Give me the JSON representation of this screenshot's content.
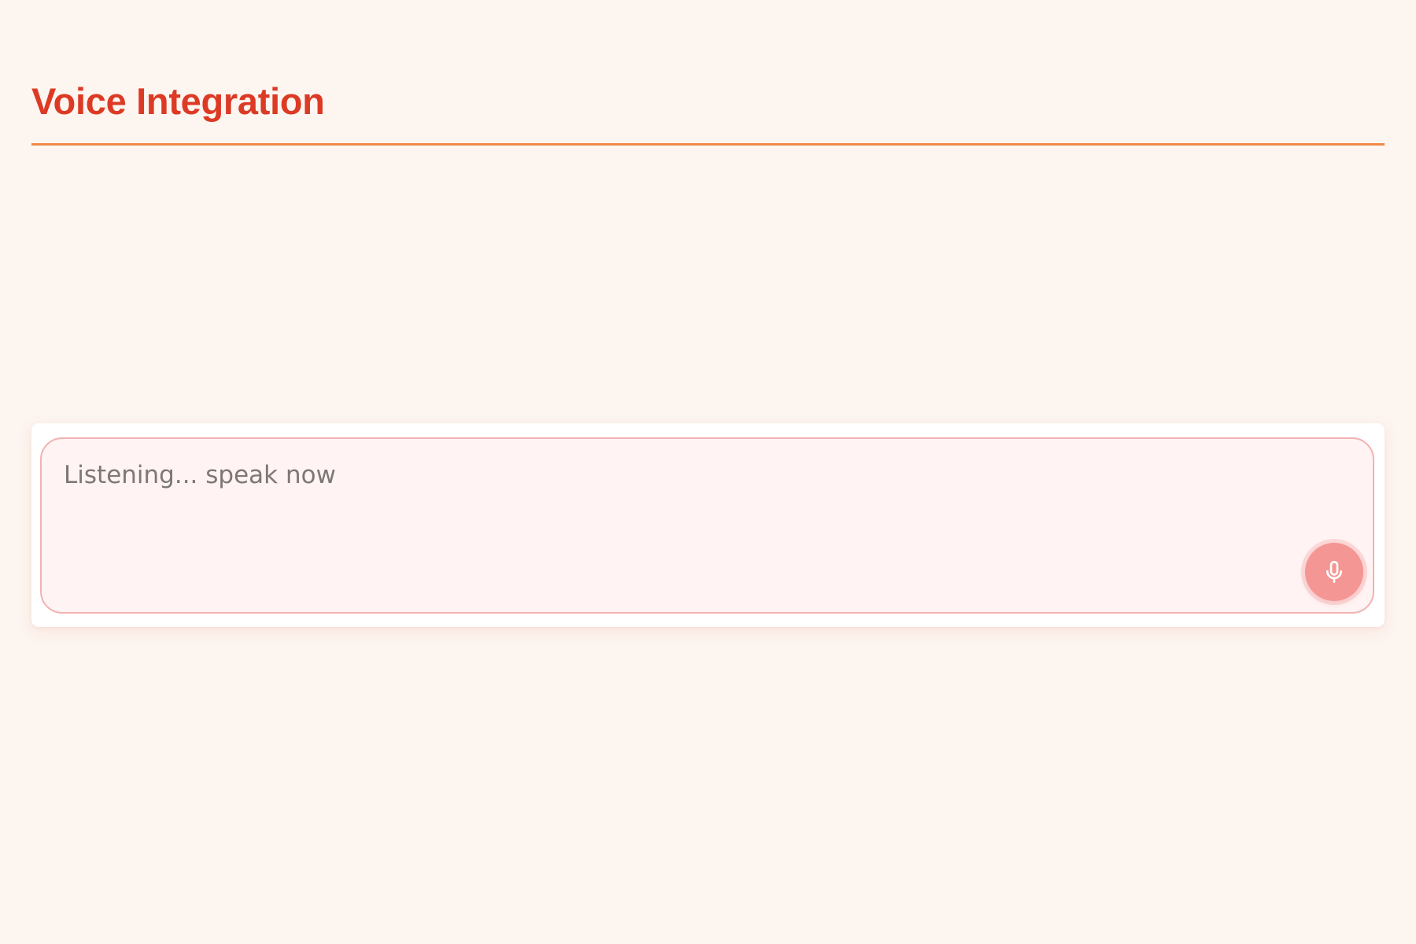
{
  "header": {
    "title": "Voice Integration"
  },
  "voice_input": {
    "value": "",
    "placeholder": "Listening... speak now",
    "state": "listening"
  },
  "mic_button": {
    "icon": "microphone-icon",
    "active": true
  },
  "colors": {
    "background": "#fdf5f0",
    "title": "#dc3a24",
    "divider": "#ef8a45",
    "input_border": "#f2b2b2",
    "input_background": "#fff3f3",
    "mic_button": "#f49693"
  }
}
